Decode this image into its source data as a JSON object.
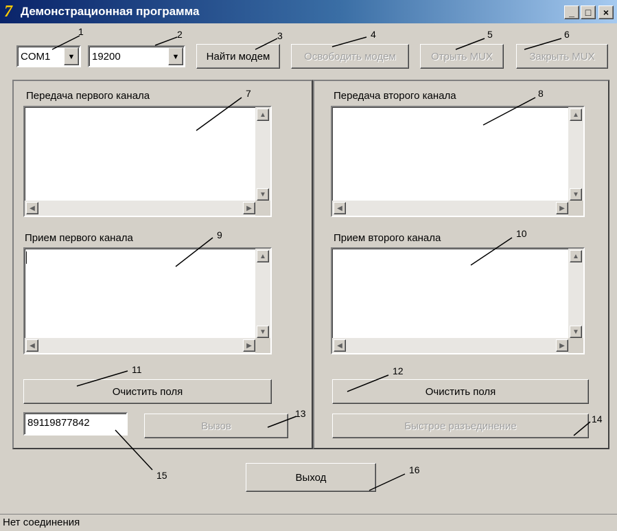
{
  "window": {
    "title": "Демонстрационная программа",
    "app_icon_glyph": "7",
    "buttons": {
      "minimize": "_",
      "maximize": "□",
      "close": "×"
    }
  },
  "toolbar": {
    "port": "COM1",
    "baud": "19200",
    "find_modem": "Найти модем",
    "release_modem": "Освободить модем",
    "open_mux": "Отрыть MUX",
    "close_mux": "Закрыть MUX"
  },
  "left": {
    "tx_label": "Передача первого канала",
    "rx_label": "Прием первого канала",
    "clear": "Очистить поля",
    "phone": "89119877842",
    "call": "Вызов"
  },
  "right": {
    "tx_label": "Передача второго канала",
    "rx_label": "Прием второго канала",
    "clear": "Очистить поля",
    "hangup": "Быстрое разъединение"
  },
  "exit": "Выход",
  "status": "Нет соединения",
  "callouts": [
    "1",
    "2",
    "3",
    "4",
    "5",
    "6",
    "7",
    "8",
    "9",
    "10",
    "11",
    "12",
    "13",
    "14",
    "15",
    "16"
  ],
  "scroll_glyphs": {
    "up": "▲",
    "down": "▼",
    "left": "◀",
    "right": "▶"
  },
  "colors": {
    "titlebar_start": "#0a246a",
    "titlebar_end": "#a6caf0",
    "face": "#d4d0c8",
    "disabled_text": "#a0a0a0"
  }
}
